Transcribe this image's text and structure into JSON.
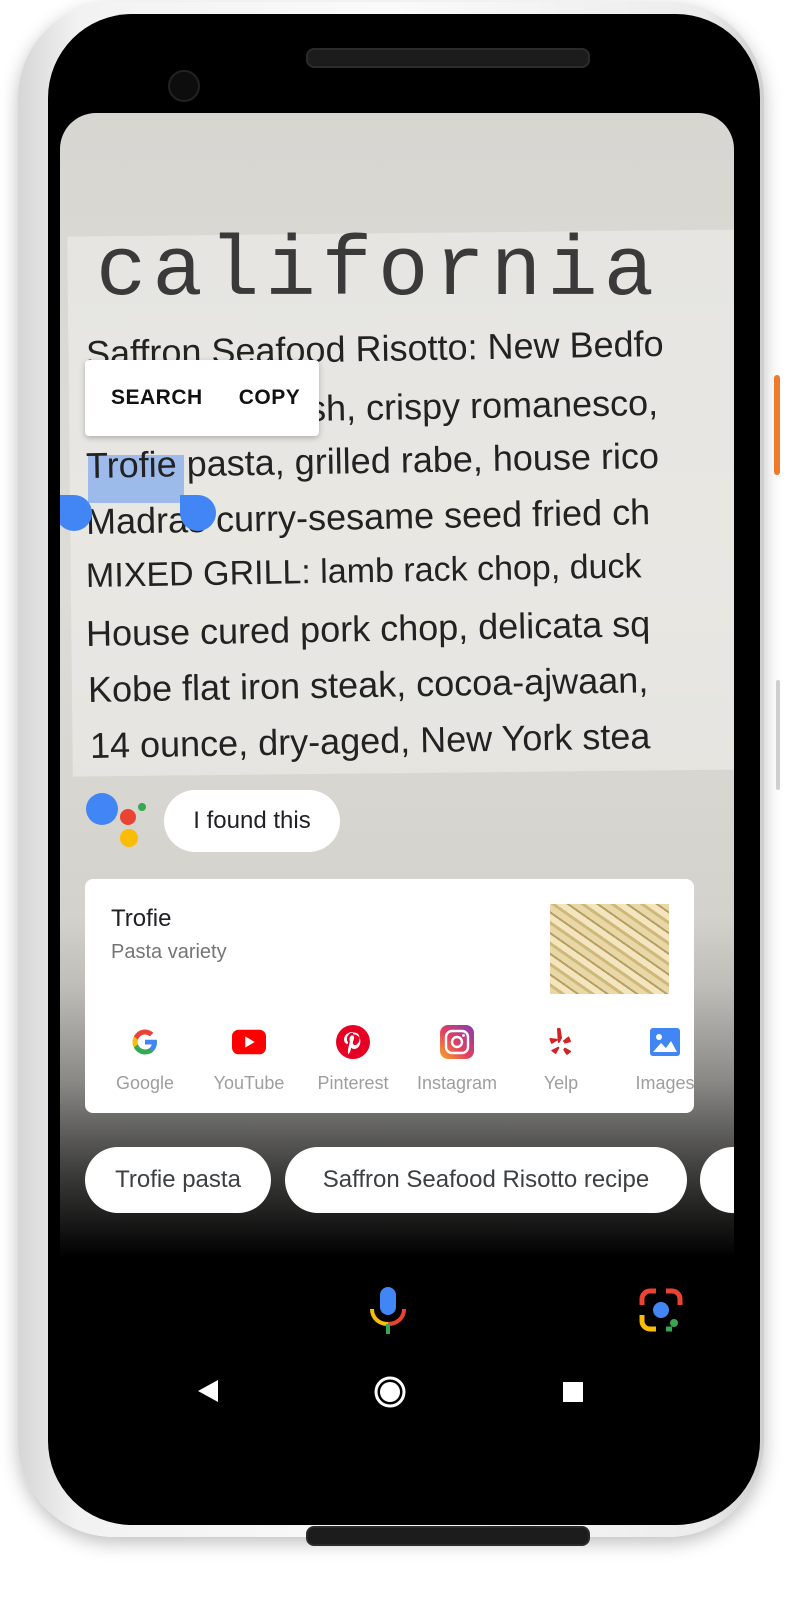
{
  "photo_text": {
    "headline": "california",
    "lines": [
      "Saffron Seafood Risotto: New Bedfo",
      "sh, crispy romanesco,",
      "Trofie pasta, grilled rabe, house rico",
      "Madras curry-sesame seed fried ch",
      "MIXED GRILL: lamb rack chop, duck",
      "House cured pork chop, delicata sq",
      "Kobe flat iron steak, cocoa-ajwaan,",
      "14 ounce, dry-aged, New York stea"
    ]
  },
  "selection_popup": {
    "search_label": "SEARCH",
    "copy_label": "COPY"
  },
  "assistant": {
    "bubble_text": "I found this"
  },
  "result_card": {
    "title": "Trofie",
    "subtitle": "Pasta variety",
    "apps": [
      {
        "label": "Google",
        "icon": "google-icon"
      },
      {
        "label": "YouTube",
        "icon": "youtube-icon"
      },
      {
        "label": "Pinterest",
        "icon": "pinterest-icon"
      },
      {
        "label": "Instagram",
        "icon": "instagram-icon"
      },
      {
        "label": "Yelp",
        "icon": "yelp-icon"
      },
      {
        "label": "Images",
        "icon": "images-icon"
      }
    ]
  },
  "suggestions": [
    "Trofie pasta",
    "Saffron Seafood Risotto recipe"
  ],
  "colors": {
    "google_blue": "#4285f4",
    "google_red": "#ea4335",
    "google_yellow": "#fbbc05",
    "google_green": "#34a853"
  }
}
